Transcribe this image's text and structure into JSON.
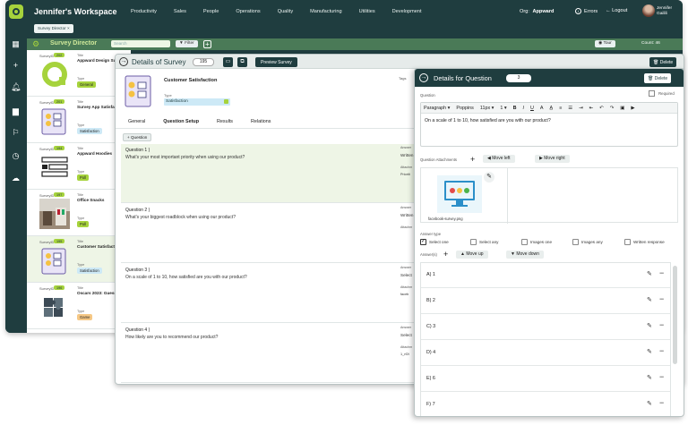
{
  "topnav": {
    "workspace_title": "Jennifer's Workspace",
    "nav_items": [
      "Productivity",
      "Sales",
      "People",
      "Operations",
      "Quality",
      "Manufacturing",
      "Utilities",
      "Development"
    ],
    "org_label": "Org:",
    "org_value": "Appward",
    "errors": "Errors",
    "logout": "Logout",
    "user_first": "Jennifer",
    "user_last": "Gailili"
  },
  "tabstrip": {
    "tab": "Survey Director",
    "close": "×"
  },
  "survey_director": {
    "title": "Survey Director",
    "search_placeholder": "Search",
    "filter": "Filter",
    "tour": "Tour",
    "count": "Count: 46"
  },
  "survey_list": [
    {
      "sid_label": "SurveyID",
      "sid": "202",
      "title_label": "Title",
      "title": "Appward Design Sur",
      "type_label": "Type",
      "type": "General",
      "type_color": "#a6d33c",
      "thumb": "logo"
    },
    {
      "sid_label": "SurveyID",
      "sid": "201",
      "title_label": "Title",
      "title": "Survey App Satisfact",
      "type_label": "Type",
      "type": "Satisfaction",
      "type_color": "#cde9f6",
      "thumb": "survey"
    },
    {
      "sid_label": "SurveyID",
      "sid": "194",
      "title_label": "Title",
      "title": "Appward Hoodies",
      "type_label": "Type",
      "type": "Poll",
      "type_color": "#a6d33c",
      "thumb": "poll"
    },
    {
      "sid_label": "SurveyID",
      "sid": "197",
      "title_label": "Title",
      "title": "Office Snacks",
      "type_label": "Type",
      "type": "Poll",
      "type_color": "#a6d33c",
      "thumb": "photo"
    },
    {
      "sid_label": "SurveyID",
      "sid": "195",
      "title_label": "Title",
      "title": "Customer Satisfaction",
      "type_label": "Type",
      "type": "Satisfaction",
      "type_color": "#cde9f6",
      "thumb": "survey"
    },
    {
      "sid_label": "SurveyID",
      "sid": "196",
      "title_label": "Title",
      "title": "Oscars 2023: Guess t",
      "type_label": "Type",
      "type": "Game",
      "type_color": "#f6c886",
      "thumb": "puzzle"
    }
  ],
  "details_survey": {
    "title": "Details of Survey",
    "number": "195",
    "preview": "Preview Survey",
    "delete": "Delete",
    "name": "Customer Satisfaction",
    "type_label": "Type",
    "type_value": "Satisfaction",
    "tags_label": "Tags",
    "tabs": [
      "General",
      "Question Setup",
      "Results",
      "Relations"
    ],
    "add_question": "Question",
    "questions": [
      {
        "num": "Question 1 )",
        "text": "What's your most important priority when using our product?",
        "ans_label": "Answer",
        "ans_val": "Written",
        "att_label": "Attachm",
        "att_val": "Prioriti"
      },
      {
        "num": "Question 2 )",
        "text": "What's your biggest roadblock when using our product?",
        "ans_label": "Answer",
        "ans_val": "Written",
        "att_label": "Attachm",
        "att_val": ""
      },
      {
        "num": "Question 3 )",
        "text": "On a scale of 1 to 10, how satisfied are you with our product?",
        "ans_label": "Answer",
        "ans_val": "Select",
        "att_label": "Attachm",
        "att_val": "faceb"
      },
      {
        "num": "Question 4 )",
        "text": "How likely are you to recommend our product?",
        "ans_label": "Answer",
        "ans_val": "Select",
        "att_label": "Attachm",
        "att_val": "1_rf2t"
      }
    ]
  },
  "details_question": {
    "title": "Details for Question",
    "number": "3",
    "delete": "Delete",
    "question_label": "Question",
    "required_label": "Required",
    "toolbar": {
      "block": "Paragraph ▾",
      "font": "Poppins",
      "size": "11px ▾",
      "line": "1 ▾"
    },
    "question_text": "On a scale of 1 to 10, how satisfied are you with our product?",
    "attachments_label": "Question Attachments",
    "move_left": "Move left",
    "move_right": "Move right",
    "attachment_name": "facebook-survey.png",
    "answer_type_label": "Answer type",
    "answer_types": [
      "Select one",
      "Select any",
      "Images one",
      "Images any",
      "Written response"
    ],
    "answers_label": "Answer(s)",
    "move_up": "Move up",
    "move_down": "Move down",
    "answers": [
      "A) 1",
      "B) 2",
      "C) 3",
      "D) 4",
      "E) 6",
      "F) 7"
    ]
  },
  "colors": {
    "primary": "#1f3d3f",
    "accent": "#a6d33c"
  }
}
